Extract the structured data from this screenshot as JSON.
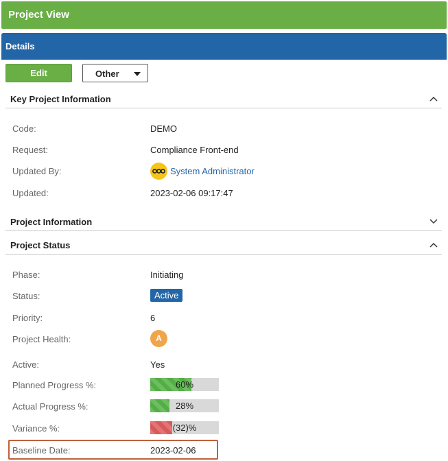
{
  "header": {
    "title": "Project View"
  },
  "details": {
    "title": "Details"
  },
  "toolbar": {
    "edit_label": "Edit",
    "other_label": "Other"
  },
  "sections": {
    "key_info": {
      "title": "Key Project Information",
      "code_label": "Code:",
      "code_value": "DEMO",
      "request_label": "Request:",
      "request_value": "Compliance Front-end",
      "updated_by_label": "Updated By:",
      "updated_by_value": "System Administrator",
      "updated_label": "Updated:",
      "updated_value": "2023-02-06 09:17:47"
    },
    "project_info": {
      "title": "Project Information"
    },
    "project_status": {
      "title": "Project Status",
      "phase_label": "Phase:",
      "phase_value": "Initiating",
      "status_label": "Status:",
      "status_value": "Active",
      "priority_label": "Priority:",
      "priority_value": "6",
      "health_label": "Project Health:",
      "health_value": "A",
      "active_label": "Active:",
      "active_value": "Yes",
      "planned_label": "Planned Progress %:",
      "planned_text": "60%",
      "planned_fraction": 0.6,
      "actual_label": "Actual Progress %:",
      "actual_text": "28%",
      "actual_fraction": 0.28,
      "variance_label": "Variance %:",
      "variance_text": "(32)%",
      "variance_fraction": 0.32,
      "baseline_label": "Baseline Date:",
      "baseline_value": "2023-02-06"
    }
  },
  "colors": {
    "header_green": "#6aaf46",
    "details_blue": "#2366a8",
    "status_badge": "#2366a8",
    "health_amber": "#f0a54a",
    "progress_green": "#5cb85c",
    "progress_red": "#e57373",
    "highlight_border": "#c0603a"
  },
  "icons": {
    "collapse": "chevron-up-icon",
    "expand": "chevron-down-icon",
    "user": "user-avatar-icon",
    "dropdown": "caret-down-icon"
  }
}
